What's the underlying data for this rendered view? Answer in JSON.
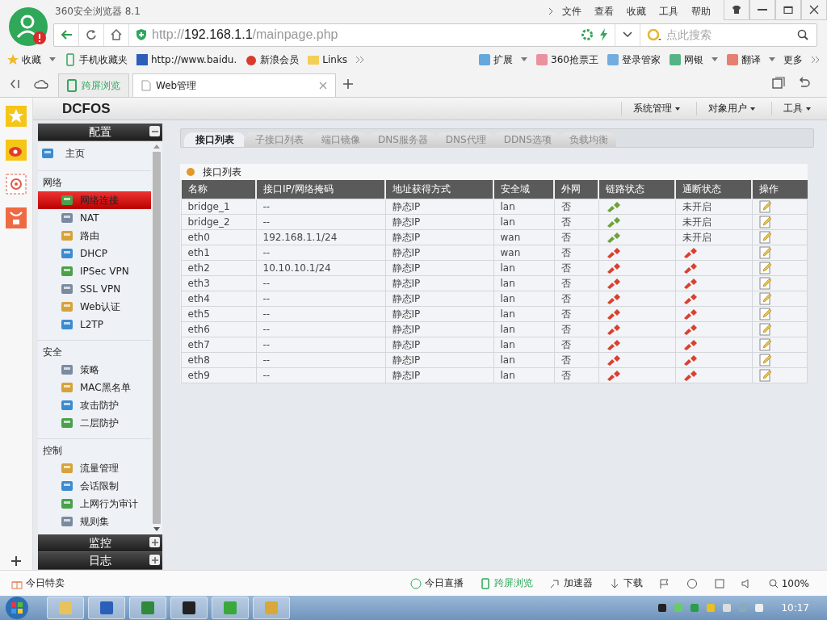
{
  "browser": {
    "title": "360安全浏览器 8.1",
    "menu": [
      "文件",
      "查看",
      "收藏",
      "工具",
      "帮助"
    ],
    "address": {
      "scheme": "http://",
      "host": "192.168.1.1",
      "path": "/mainpage.php"
    },
    "search": {
      "placeholder": "点此搜索"
    },
    "bookmarks_left": [
      "收藏",
      "手机收藏夹",
      "http://www.baidu.",
      "新浪会员",
      "Links"
    ],
    "bookmarks_right": [
      "扩展",
      "360抢票王",
      "登录管家",
      "网银",
      "翻译",
      "更多"
    ],
    "tabs": [
      {
        "label": "跨屏浏览",
        "selected": false
      },
      {
        "label": "Web管理",
        "selected": true
      }
    ]
  },
  "app": {
    "logo": "DCFOS",
    "menu": [
      "系统管理",
      "对象用户",
      "工具"
    ]
  },
  "sidebar": {
    "panels": [
      {
        "title": "配置",
        "expanded": true,
        "sections": [
          {
            "items": [
              {
                "label": "主页",
                "selected": false
              }
            ]
          },
          {
            "heading": "网络",
            "items": [
              {
                "label": "网络连接",
                "selected": true
              },
              {
                "label": "NAT",
                "selected": false
              },
              {
                "label": "路由",
                "selected": false
              },
              {
                "label": "DHCP",
                "selected": false
              },
              {
                "label": "IPSec VPN",
                "selected": false
              },
              {
                "label": "SSL VPN",
                "selected": false
              },
              {
                "label": "Web认证",
                "selected": false
              },
              {
                "label": "L2TP",
                "selected": false
              }
            ]
          },
          {
            "heading": "安全",
            "items": [
              {
                "label": "策略",
                "selected": false
              },
              {
                "label": "MAC黑名单",
                "selected": false
              },
              {
                "label": "攻击防护",
                "selected": false
              },
              {
                "label": "二层防护",
                "selected": false
              }
            ]
          },
          {
            "heading": "控制",
            "items": [
              {
                "label": "流量管理",
                "selected": false
              },
              {
                "label": "会话限制",
                "selected": false
              },
              {
                "label": "上网行为审计",
                "selected": false
              },
              {
                "label": "规则集",
                "selected": false
              }
            ]
          }
        ]
      },
      {
        "title": "监控",
        "expanded": false
      },
      {
        "title": "日志",
        "expanded": false
      }
    ]
  },
  "tabs": [
    {
      "label": "接口列表",
      "selected": true
    },
    {
      "label": "子接口列表",
      "selected": false
    },
    {
      "label": "端口镜像",
      "selected": false
    },
    {
      "label": "DNS服务器",
      "selected": false
    },
    {
      "label": "DNS代理",
      "selected": false
    },
    {
      "label": "DDNS选项",
      "selected": false
    },
    {
      "label": "负载均衡",
      "selected": false
    }
  ],
  "table": {
    "title": "接口列表",
    "columns": [
      "名称",
      "接口IP/网络掩码",
      "地址获得方式",
      "安全域",
      "外网",
      "链路状态",
      "通断状态",
      "操作"
    ],
    "rows": [
      {
        "name": "bridge_1",
        "ip": "--",
        "method": "静态IP",
        "zone": "lan",
        "wan": "否",
        "link_up": true,
        "ping": {
          "kind": "text",
          "text": "未开启"
        }
      },
      {
        "name": "bridge_2",
        "ip": "--",
        "method": "静态IP",
        "zone": "lan",
        "wan": "否",
        "link_up": true,
        "ping": {
          "kind": "text",
          "text": "未开启"
        }
      },
      {
        "name": "eth0",
        "ip": "192.168.1.1/24",
        "method": "静态IP",
        "zone": "wan",
        "wan": "否",
        "link_up": true,
        "ping": {
          "kind": "text",
          "text": "未开启"
        }
      },
      {
        "name": "eth1",
        "ip": "--",
        "method": "静态IP",
        "zone": "wan",
        "wan": "否",
        "link_up": false,
        "ping": {
          "kind": "icon",
          "up": false
        }
      },
      {
        "name": "eth2",
        "ip": "10.10.10.1/24",
        "method": "静态IP",
        "zone": "lan",
        "wan": "否",
        "link_up": false,
        "ping": {
          "kind": "icon",
          "up": false
        }
      },
      {
        "name": "eth3",
        "ip": "--",
        "method": "静态IP",
        "zone": "lan",
        "wan": "否",
        "link_up": false,
        "ping": {
          "kind": "icon",
          "up": false
        }
      },
      {
        "name": "eth4",
        "ip": "--",
        "method": "静态IP",
        "zone": "lan",
        "wan": "否",
        "link_up": false,
        "ping": {
          "kind": "icon",
          "up": false
        }
      },
      {
        "name": "eth5",
        "ip": "--",
        "method": "静态IP",
        "zone": "lan",
        "wan": "否",
        "link_up": false,
        "ping": {
          "kind": "icon",
          "up": false
        }
      },
      {
        "name": "eth6",
        "ip": "--",
        "method": "静态IP",
        "zone": "lan",
        "wan": "否",
        "link_up": false,
        "ping": {
          "kind": "icon",
          "up": false
        }
      },
      {
        "name": "eth7",
        "ip": "--",
        "method": "静态IP",
        "zone": "lan",
        "wan": "否",
        "link_up": false,
        "ping": {
          "kind": "icon",
          "up": false
        }
      },
      {
        "name": "eth8",
        "ip": "--",
        "method": "静态IP",
        "zone": "lan",
        "wan": "否",
        "link_up": false,
        "ping": {
          "kind": "icon",
          "up": false
        }
      },
      {
        "name": "eth9",
        "ip": "--",
        "method": "静态IP",
        "zone": "lan",
        "wan": "否",
        "link_up": false,
        "ping": {
          "kind": "icon",
          "up": false
        }
      }
    ]
  },
  "status_bar": {
    "left": "今日特卖",
    "items": [
      "今日直播",
      "跨屏浏览",
      "加速器",
      "下载"
    ],
    "zoom": "100%"
  },
  "taskbar": {
    "clock": "10:17"
  }
}
